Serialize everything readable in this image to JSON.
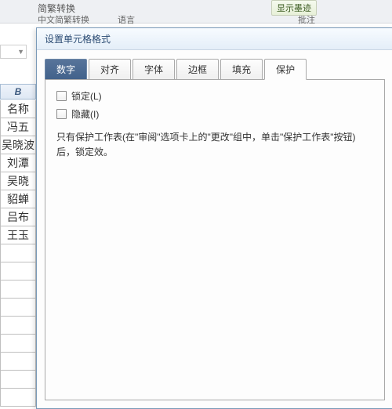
{
  "ribbon": {
    "partial_top": "简繁转换",
    "group1": "中文简繁转换",
    "group2": "语言",
    "group3": "批注",
    "btn_right": "显示墨迹"
  },
  "sheet": {
    "col_header": "B",
    "cells": [
      "名称",
      "冯五",
      "吴晓波",
      "刘潭",
      "吴晓",
      "貂蝉",
      "吕布",
      "王玉"
    ]
  },
  "dialog": {
    "title": "设置单元格格式",
    "tabs": [
      "数字",
      "对齐",
      "字体",
      "边框",
      "填充",
      "保护"
    ],
    "active_tab_index": 5,
    "selected_tab_index": 0,
    "protect": {
      "lock_label": "锁定(L)",
      "hide_label": "隐藏(I)",
      "hint": "只有保护工作表(在\"审阅\"选项卡上的\"更改\"组中，单击\"保护工作表\"按钮)后，锁定效。"
    }
  }
}
